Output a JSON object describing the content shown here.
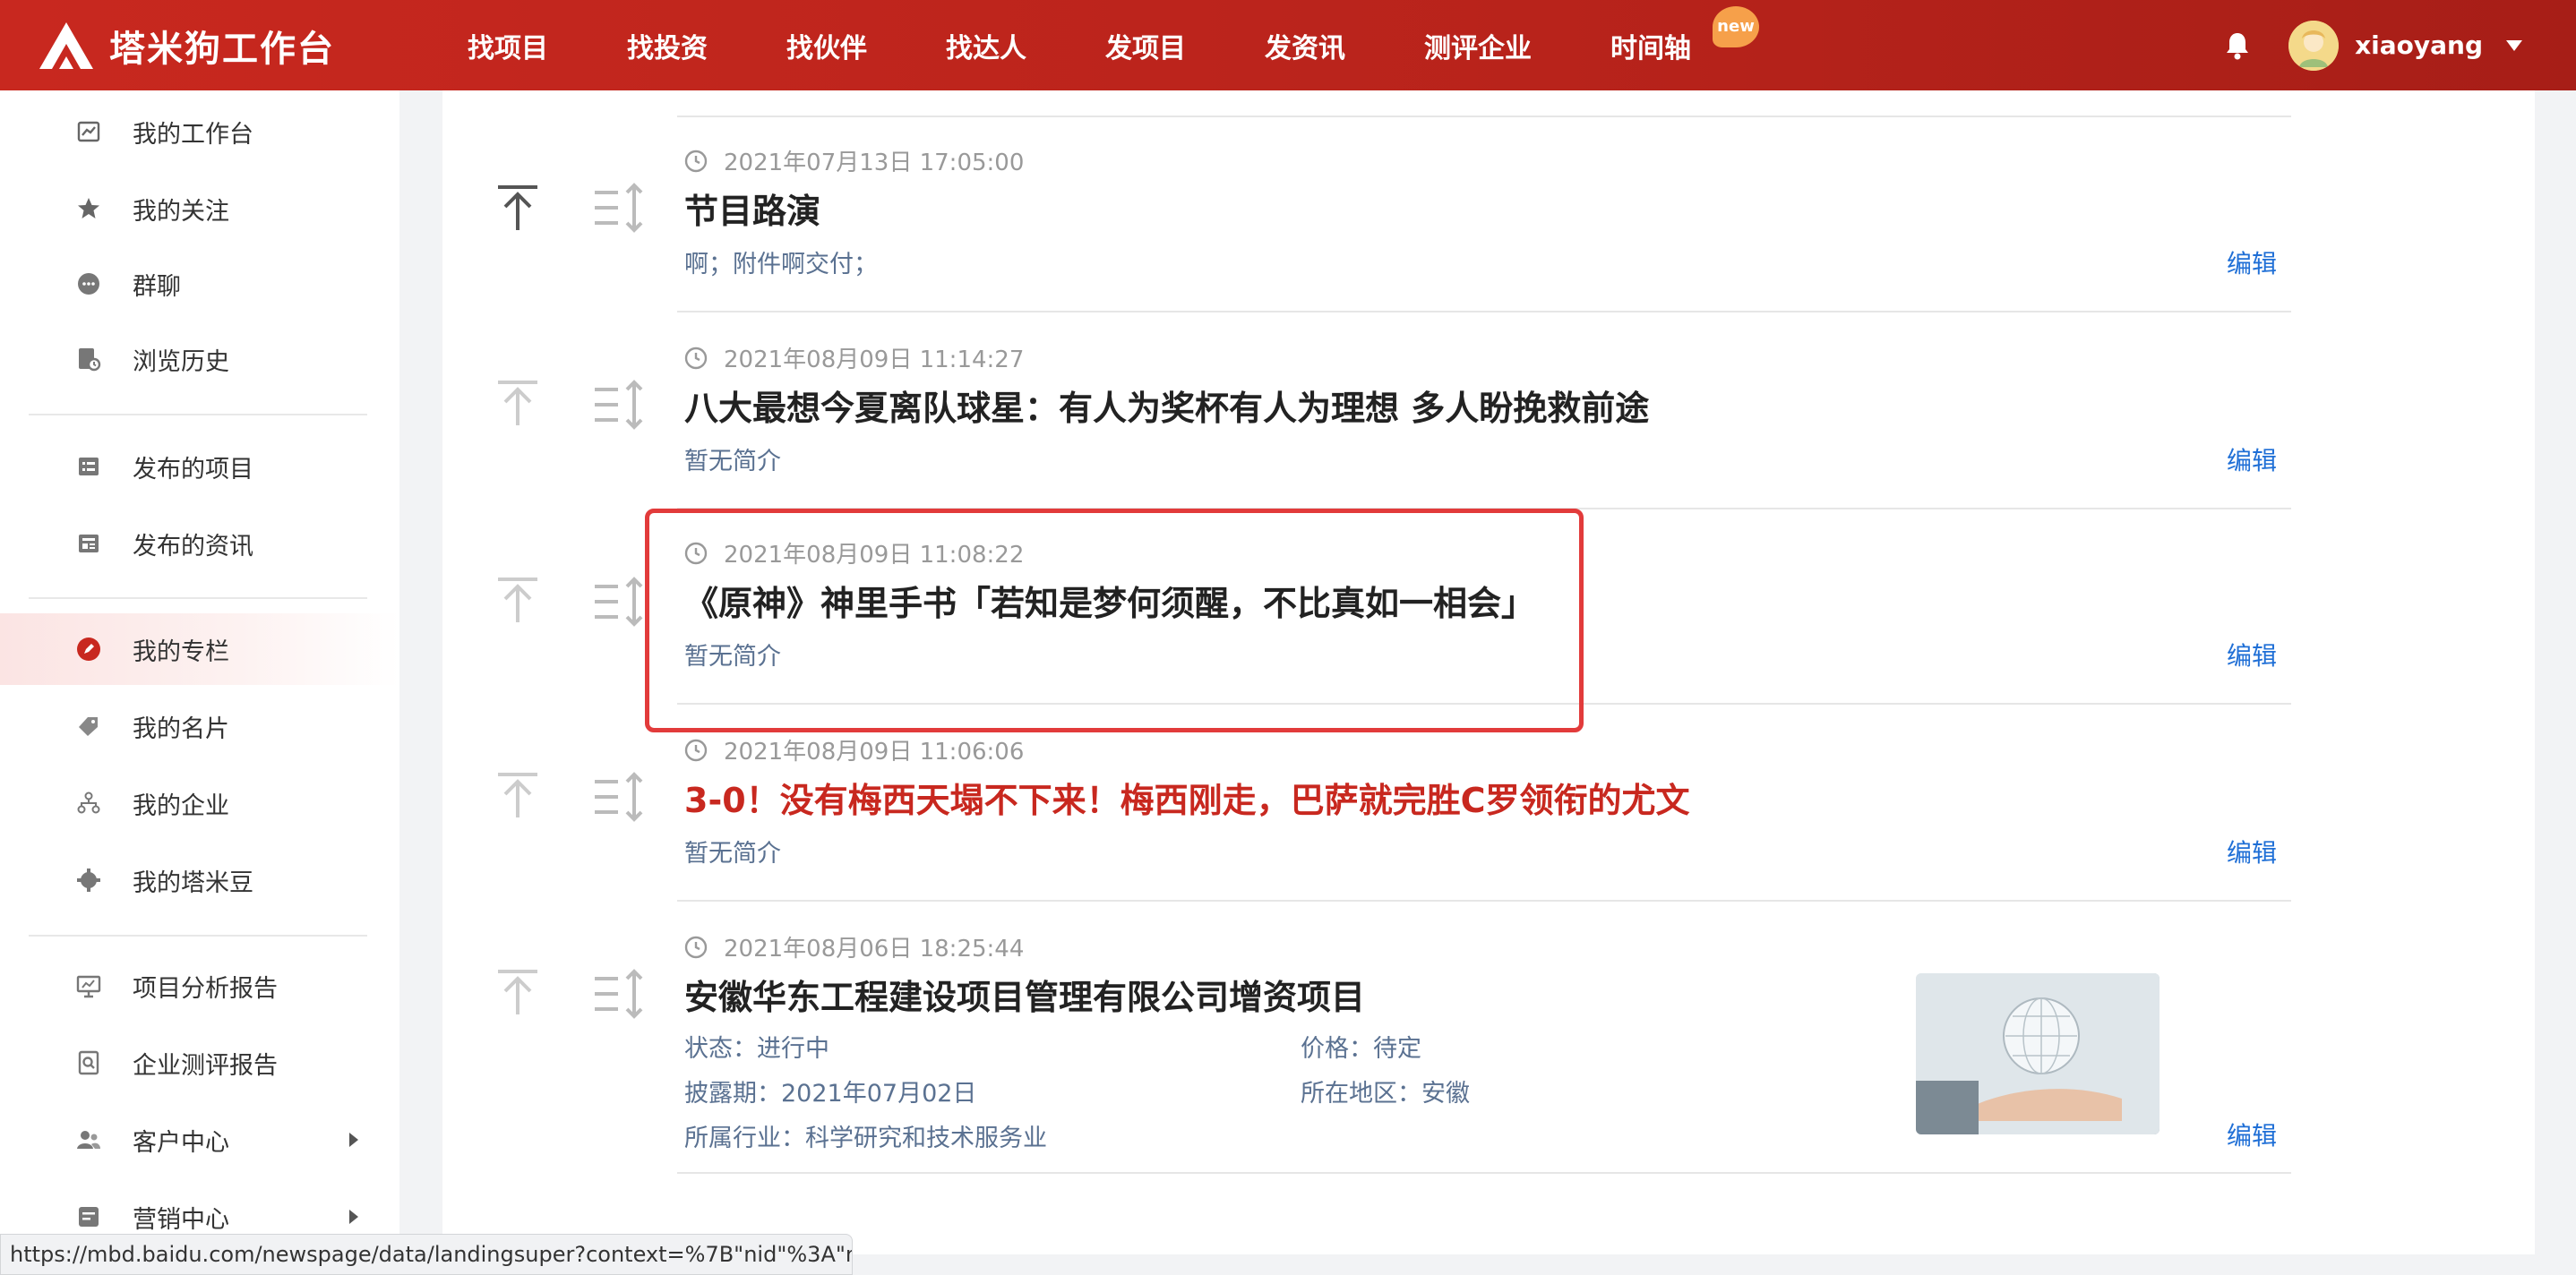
{
  "app": {
    "title": "塔米狗工作台"
  },
  "nav": {
    "items": [
      "找项目",
      "找投资",
      "找伙伴",
      "找达人",
      "发项目",
      "发资讯",
      "测评企业",
      "时间轴"
    ],
    "new_badge": "new"
  },
  "user": {
    "name": "xiaoyang"
  },
  "sidebar": {
    "items": [
      {
        "label": "我的工作台",
        "icon": "chart-icon"
      },
      {
        "label": "我的关注",
        "icon": "star-icon"
      },
      {
        "label": "群聊",
        "icon": "chat-icon"
      },
      {
        "label": "浏览历史",
        "icon": "history-icon"
      },
      {
        "label": "发布的项目",
        "icon": "list-icon"
      },
      {
        "label": "发布的资讯",
        "icon": "news-icon"
      },
      {
        "label": "我的专栏",
        "icon": "column-icon"
      },
      {
        "label": "我的名片",
        "icon": "tag-icon"
      },
      {
        "label": "我的企业",
        "icon": "org-icon"
      },
      {
        "label": "我的塔米豆",
        "icon": "gear-icon"
      },
      {
        "label": "项目分析报告",
        "icon": "report-icon"
      },
      {
        "label": "企业测评报告",
        "icon": "search-doc-icon"
      },
      {
        "label": "客户中心",
        "icon": "users-icon"
      },
      {
        "label": "营销中心",
        "icon": "marketing-icon"
      }
    ],
    "active_index": 6
  },
  "articles": [
    {
      "time": "2021年07月13日 17:05:00",
      "title": "节目路演",
      "summary": "啊；附件啊交付；",
      "edit": "编辑",
      "title_red": false
    },
    {
      "time": "2021年08月09日 11:14:27",
      "title": "八大最想今夏离队球星：有人为奖杯有人为理想 多人盼挽救前途",
      "summary": "暂无简介",
      "edit": "编辑",
      "title_red": false
    },
    {
      "time": "2021年08月09日 11:08:22",
      "title": "《原神》神里手书「若知是梦何须醒，不比真如一相会」",
      "summary": "暂无简介",
      "edit": "编辑",
      "title_red": false
    },
    {
      "time": "2021年08月09日 11:06:06",
      "title": "3-0！没有梅西天塌不下来！梅西刚走，巴萨就完胜C罗领衔的尤文",
      "summary": "暂无简介",
      "edit": "编辑",
      "title_red": true
    },
    {
      "time": "2021年08月06日 18:25:44",
      "title": "安徽华东工程建设项目管理有限公司增资项目",
      "edit": "编辑",
      "meta": {
        "status": "状态：进行中",
        "price": "价格：待定",
        "disclosure": "披露期：2021年07月02日",
        "region": "所在地区：安徽",
        "industry": "所属行业：科学研究和技术服务业"
      }
    }
  ],
  "statusbar": {
    "url": "https://mbd.baidu.com/newspage/data/landingsuper?context=%7B\"nid\"%3A\"ne..."
  },
  "colors": {
    "brand": "#c8281f",
    "link": "#1f6fd6",
    "summary": "#5a7191",
    "highlight": "#e23b3b"
  }
}
